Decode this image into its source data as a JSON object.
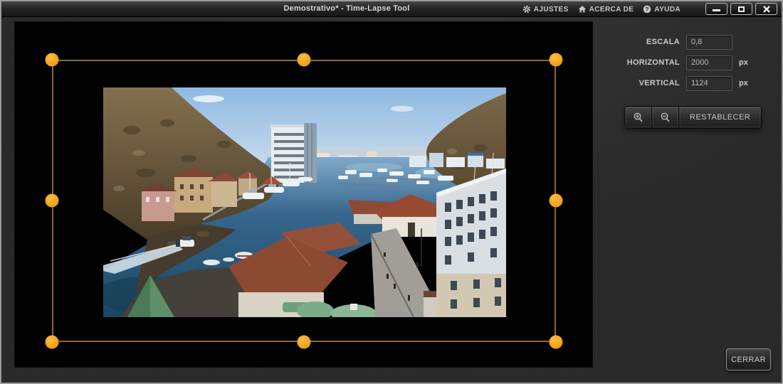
{
  "window": {
    "title": "Demostrativo* - Time-Lapse Tool"
  },
  "titlebar": {
    "menu": [
      {
        "label": "AJUSTES",
        "icon": "gear-icon"
      },
      {
        "label": "ACERCA DE",
        "icon": "home-icon"
      },
      {
        "label": "AYUDA",
        "icon": "help-icon"
      }
    ],
    "help_glyph": "?"
  },
  "editor": {
    "photo_description": "Harbor bay panorama: hills on both sides, blue bay with marina boats, red-roofed waterfront buildings and a motorboat with wake",
    "frame_line_color": "#8a6a2e",
    "handle_color": "#f0a41c",
    "handle_count": 8
  },
  "panel": {
    "fields": [
      {
        "label": "ESCALA",
        "value": "0,8",
        "unit": ""
      },
      {
        "label": "HORIZONTAL",
        "value": "2000",
        "unit": "px"
      },
      {
        "label": "VERTICAL",
        "value": "1124",
        "unit": "px"
      }
    ],
    "reset_label": "RESTABLECER"
  },
  "footer": {
    "close_label": "CERRAR"
  }
}
